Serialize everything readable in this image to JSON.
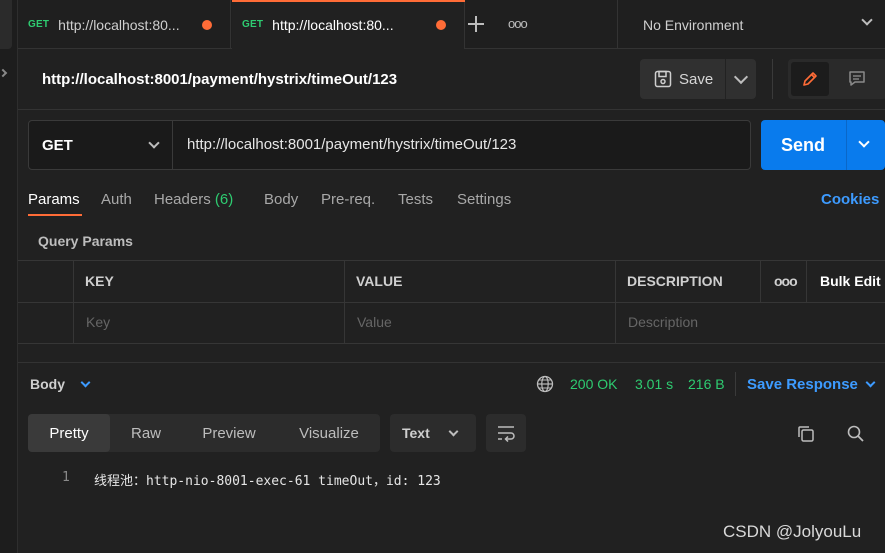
{
  "tabs": [
    {
      "method": "GET",
      "url": "http://localhost:80..."
    },
    {
      "method": "GET",
      "url": "http://localhost:80..."
    }
  ],
  "tabs_more": "ooo",
  "environment": "No Environment",
  "request_title": "http://localhost:8001/payment/hystrix/timeOut/123",
  "save": {
    "label": "Save"
  },
  "request": {
    "method": "GET",
    "url": "http://localhost:8001/payment/hystrix/timeOut/123",
    "send_label": "Send"
  },
  "request_tabs": {
    "params": "Params",
    "auth": "Auth",
    "headers": "Headers",
    "headers_count": "(6)",
    "body": "Body",
    "prereq": "Pre-req.",
    "tests": "Tests",
    "settings": "Settings",
    "cookies": "Cookies"
  },
  "query_params": {
    "title": "Query Params",
    "columns": {
      "key": "KEY",
      "value": "VALUE",
      "description": "DESCRIPTION"
    },
    "more": "ooo",
    "bulk_edit": "Bulk Edit",
    "placeholders": {
      "key": "Key",
      "value": "Value",
      "description": "Description"
    }
  },
  "response": {
    "body_label": "Body",
    "status": "200 OK",
    "time": "3.01 s",
    "size": "216 B",
    "save_response": "Save Response",
    "views": [
      "Pretty",
      "Raw",
      "Preview",
      "Visualize"
    ],
    "format": "Text",
    "lines": [
      {
        "num": "1",
        "text": "线程池：http-nio-8001-exec-61 timeOut，id: 123"
      }
    ]
  },
  "watermark": "CSDN @JolyouLu",
  "colors": {
    "accent_orange": "#ff6c37",
    "send_blue": "#097bed",
    "link_blue": "#3d9bff",
    "status_green": "#2ecc71"
  }
}
